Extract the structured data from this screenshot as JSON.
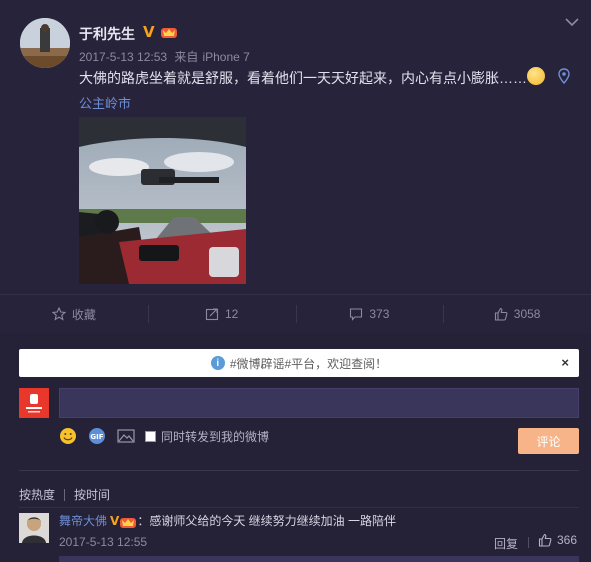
{
  "post": {
    "author": "于利先生",
    "verified_mark": "V",
    "timestamp": "2017-5-13 12:53",
    "source_prefix": "来自",
    "source": "iPhone 7",
    "text": "大佛的路虎坐着就是舒服，看着他们一天天好起来，内心有点小膨胀……",
    "location": "公主岭市",
    "icons": {
      "crown": "vip-crown-icon",
      "more": "chevron-down-icon",
      "location": "location-pin-icon",
      "emoji": "emoji-face-icon"
    }
  },
  "actions": {
    "favorite_label": "收藏",
    "repost_count": "12",
    "comment_count": "373",
    "like_count": "3058"
  },
  "comments": {
    "notice_text": "#微博辟谣#平台，欢迎查阅！",
    "notice_close": "×",
    "notice_icon": "i",
    "repost_option_label": "同时转发到我的微博",
    "submit_label": "评论",
    "sort_hot": "按热度",
    "sort_time": "按时间",
    "tool_icons": [
      "emoji-icon",
      "gif-icon",
      "image-icon"
    ],
    "items": [
      {
        "author": "舞帝大佛",
        "verified_mark": "V",
        "text": "：感谢师父给的今天 继续努力继续加油 一路陪伴",
        "time": "2017-5-13 12:55",
        "reply_label": "回复",
        "like_count": "366"
      }
    ]
  },
  "colors": {
    "background": "#27233a",
    "link": "#6e8ed6",
    "verified": "#f7a21a",
    "submit": "#f8b489"
  }
}
